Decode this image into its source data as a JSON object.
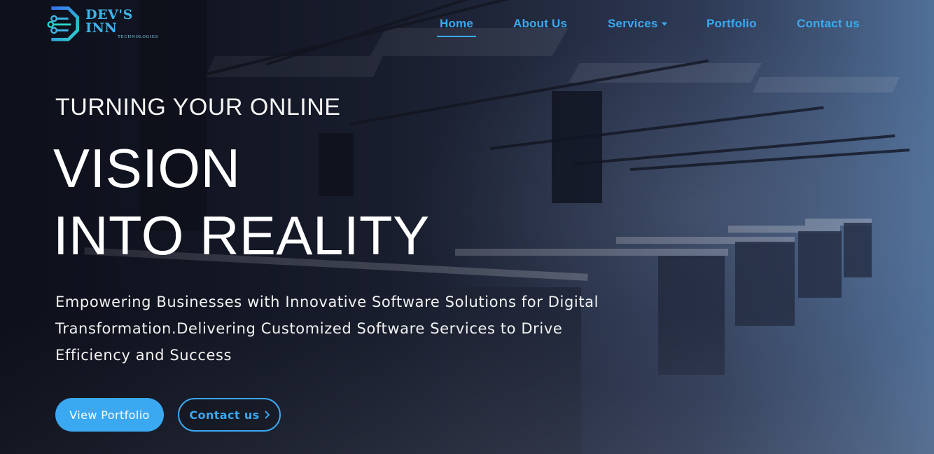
{
  "brand": {
    "name": "DEV'S INN",
    "subtitle": "TECHNOLOGIES",
    "accent_color": "#3ba8f2"
  },
  "nav": {
    "items": [
      {
        "label": "Home",
        "active": true
      },
      {
        "label": "About Us",
        "active": false
      },
      {
        "label": "Services",
        "active": false,
        "has_dropdown": true
      },
      {
        "label": "Portfolio",
        "active": false
      },
      {
        "label": "Contact us",
        "active": false
      }
    ]
  },
  "hero": {
    "eyebrow": "TURNING YOUR ONLINE",
    "headline_line1": "VISION",
    "headline_line2": "INTO REALITY",
    "description": "Empowering Businesses with Innovative Software Solutions for Digital Transformation.Delivering Customized Software Services to Drive Efficiency and Success",
    "primary_button": "View Portfolio",
    "secondary_button": "Contact us",
    "secondary_icon": "chevron-right-icon"
  }
}
